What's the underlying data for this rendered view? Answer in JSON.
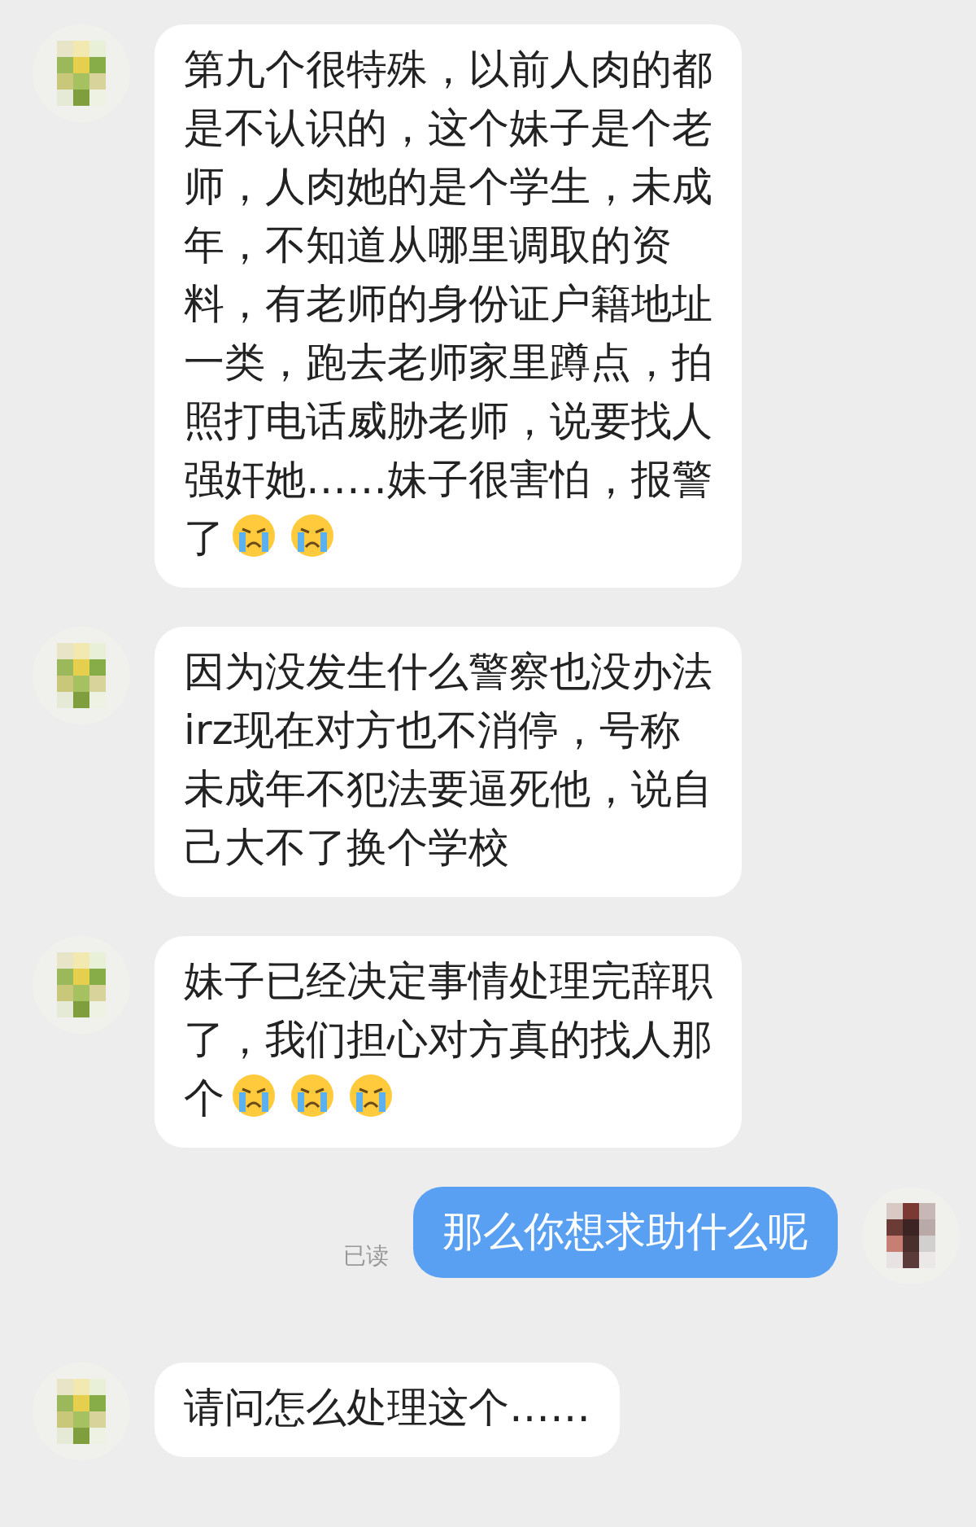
{
  "messages": [
    {
      "kind": "incoming",
      "parts": [
        {
          "kind": "text",
          "text": "第九个很特殊，以前人肉的都是不认识的，这个妹子是个老师，人肉她的是个学生，未成年，不知道从哪里调取的资料，有老师的身份证户籍地址一类，跑去老师家里蹲点，拍照打电话威胁老师，说要找人强奸她……妹子很害怕，报警了"
        },
        {
          "kind": "emoji"
        },
        {
          "kind": "emoji"
        }
      ]
    },
    {
      "kind": "incoming",
      "parts": [
        {
          "kind": "text",
          "text": "因为没发生什么警察也没办法irz现在对方也不消停，号称未成年不犯法要逼死他，说自己大不了换个学校"
        }
      ]
    },
    {
      "kind": "incoming",
      "parts": [
        {
          "kind": "text",
          "text": "妹子已经决定事情处理完辞职了，我们担心对方真的找人那个"
        },
        {
          "kind": "emoji"
        },
        {
          "kind": "emoji"
        },
        {
          "kind": "emoji"
        }
      ]
    },
    {
      "kind": "outgoing",
      "status": "已读",
      "parts": [
        {
          "kind": "text",
          "text": "那么你想求助什么呢"
        }
      ]
    },
    {
      "kind": "incoming",
      "parts": [
        {
          "kind": "text",
          "text": "请问怎么处理这个……"
        }
      ]
    }
  ]
}
